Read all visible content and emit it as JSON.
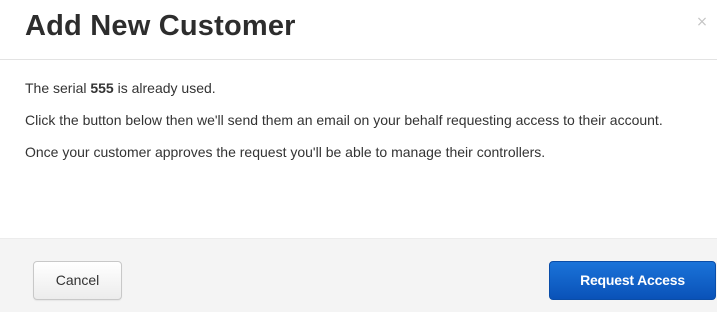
{
  "dialog": {
    "title": "Add New Customer",
    "close_glyph": "×"
  },
  "body": {
    "serial_prefix": "The serial ",
    "serial_number": "555",
    "serial_suffix": " is already used.",
    "instructions": "Click the button below then we'll send them an email on your behalf requesting access to their account.",
    "approval_note": "Once your customer approves the request you'll be able to manage their controllers."
  },
  "footer": {
    "cancel_label": "Cancel",
    "request_label": "Request Access"
  },
  "colors": {
    "primary": "#1a6fd6",
    "footer_bg": "#f4f4f4",
    "title": "#2d2d2d"
  },
  "icons": {
    "close": "close-icon"
  }
}
